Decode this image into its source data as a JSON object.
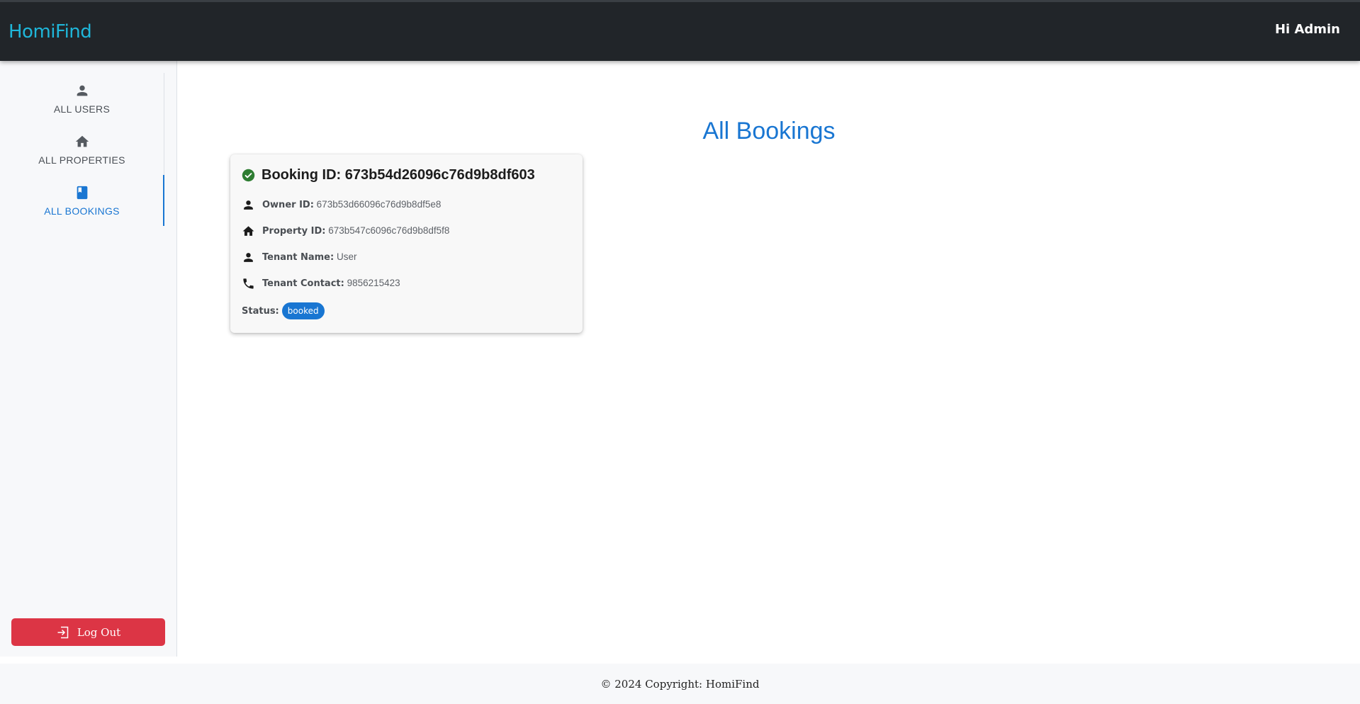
{
  "header": {
    "brand": "HomiFind",
    "greeting": "Hi Admin"
  },
  "sidebar": {
    "items": [
      {
        "label": "ALL USERS",
        "icon": "person-icon",
        "active": false
      },
      {
        "label": "ALL PROPERTIES",
        "icon": "home-icon",
        "active": false
      },
      {
        "label": "ALL BOOKINGS",
        "icon": "book-icon",
        "active": true
      }
    ],
    "logout_label": "Log Out"
  },
  "main": {
    "title": "All Bookings",
    "booking": {
      "title": "Booking ID: 673b54d26096c76d9b8df603",
      "owner_label": "Owner ID:",
      "owner_value": "673b53d66096c76d9b8df5e8",
      "property_label": "Property ID:",
      "property_value": "673b547c6096c76d9b8df5f8",
      "tenant_name_label": "Tenant Name:",
      "tenant_name_value": "User",
      "tenant_contact_label": "Tenant Contact:",
      "tenant_contact_value": "9856215423",
      "status_label": "Status:",
      "status_value": "booked"
    }
  },
  "footer": {
    "text": "© 2024 Copyright: HomiFind"
  },
  "colors": {
    "accent": "#1976d2",
    "navbar": "#212529",
    "brand": "#1fb6d9",
    "logout": "#dc3545",
    "check": "#2e7d32"
  }
}
